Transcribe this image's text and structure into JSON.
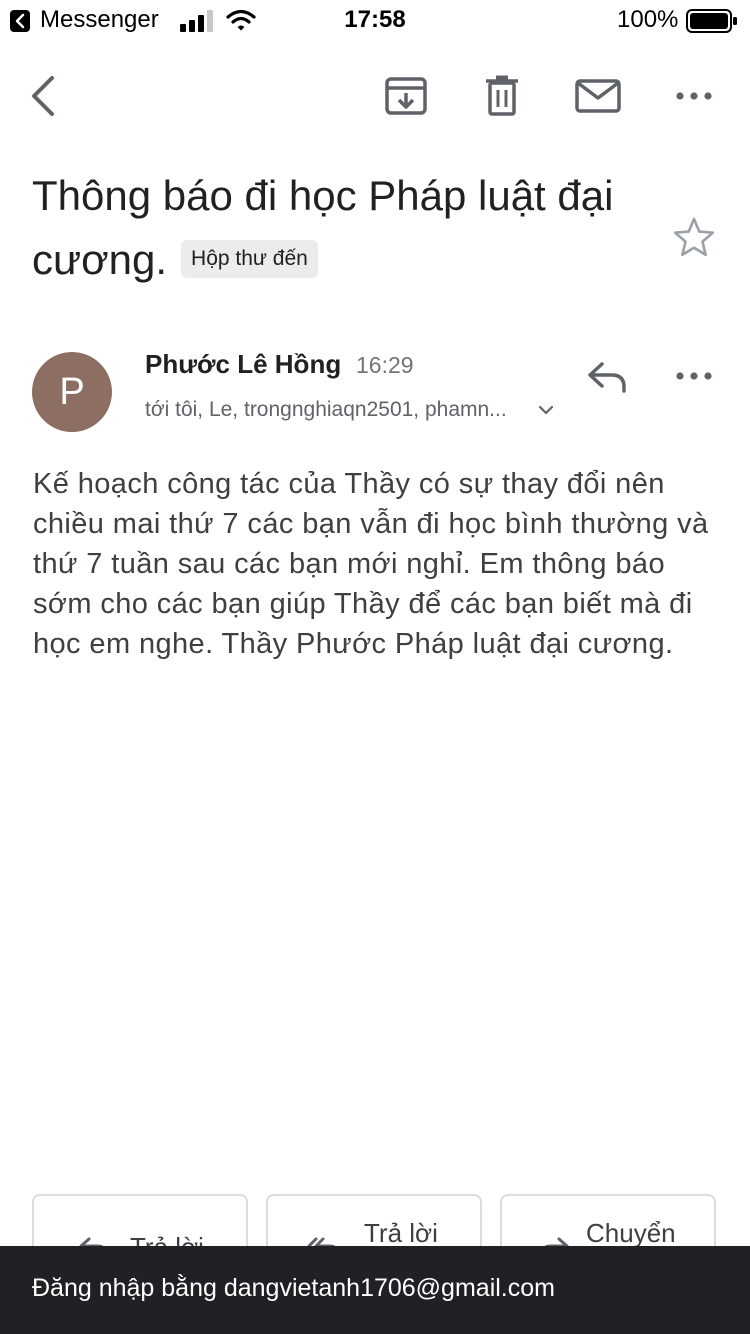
{
  "status_bar": {
    "app": "Messenger",
    "time": "17:58",
    "battery": "100%"
  },
  "toolbar": {
    "icons": [
      "back-icon",
      "archive-icon",
      "delete-icon",
      "mail-icon",
      "more-icon"
    ]
  },
  "email": {
    "subject": "Thông báo đi học Pháp luật đại cương.",
    "label": "Hộp thư đến",
    "sender": {
      "initial": "P",
      "name": "Phước Lê Hồng",
      "time": "16:29",
      "recipients": "tới tôi, Le, trongnghiaqn2501, phamn..."
    },
    "body": "Kế hoạch công tác của Thầy có sự thay đổi nên chiều mai thứ 7 các bạn vẫn đi học bình thường và thứ 7 tuần sau các bạn mới nghỉ. Em thông báo sớm cho các bạn giúp Thầy để các bạn biết mà đi học em nghe. Thầy Phước Pháp luật đại cương."
  },
  "actions": {
    "reply": "Trả lời",
    "reply_all": "Trả lời",
    "forward": "Chuyển"
  },
  "snackbar": {
    "text": "Đăng nhập bằng dangvietanh1706@gmail.com"
  },
  "colors": {
    "avatar": "#8d6e63",
    "snackbar": "#202124",
    "badge": "#ececec"
  }
}
